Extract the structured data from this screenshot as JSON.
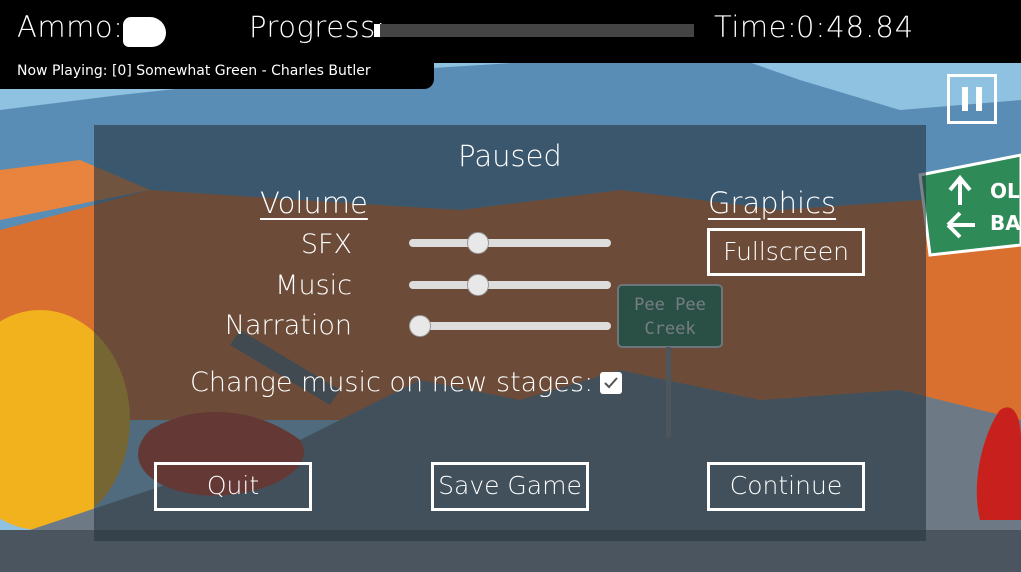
{
  "hud": {
    "ammo_label": "Ammo:",
    "progress_label": "Progress:",
    "progress_value": 0.02,
    "time_label": "Time:",
    "time_value": "0:48.84",
    "now_playing": "Now Playing: [0] Somewhat Green - Charles Butler"
  },
  "scene": {
    "sign_text": "Pee Pee Creek",
    "road_sign_text": "OL BA"
  },
  "pause_menu": {
    "title": "Paused",
    "volume_heading": "Volume",
    "graphics_heading": "Graphics",
    "sliders": [
      {
        "label": "SFX",
        "value": 0.32
      },
      {
        "label": "Music",
        "value": 0.32
      },
      {
        "label": "Narration",
        "value": 0.0
      }
    ],
    "fullscreen_button": "Fullscreen",
    "change_music_label": "Change music on new stages:",
    "change_music_checked": true,
    "quit_button": "Quit",
    "save_button": "Save Game",
    "continue_button": "Continue"
  },
  "colors": {
    "sky": "#7fb3d6",
    "mountain": "#4a6f8c",
    "orange_hill": "#d96a2e",
    "panel": "#28373f",
    "hud_bg": "#000000"
  }
}
